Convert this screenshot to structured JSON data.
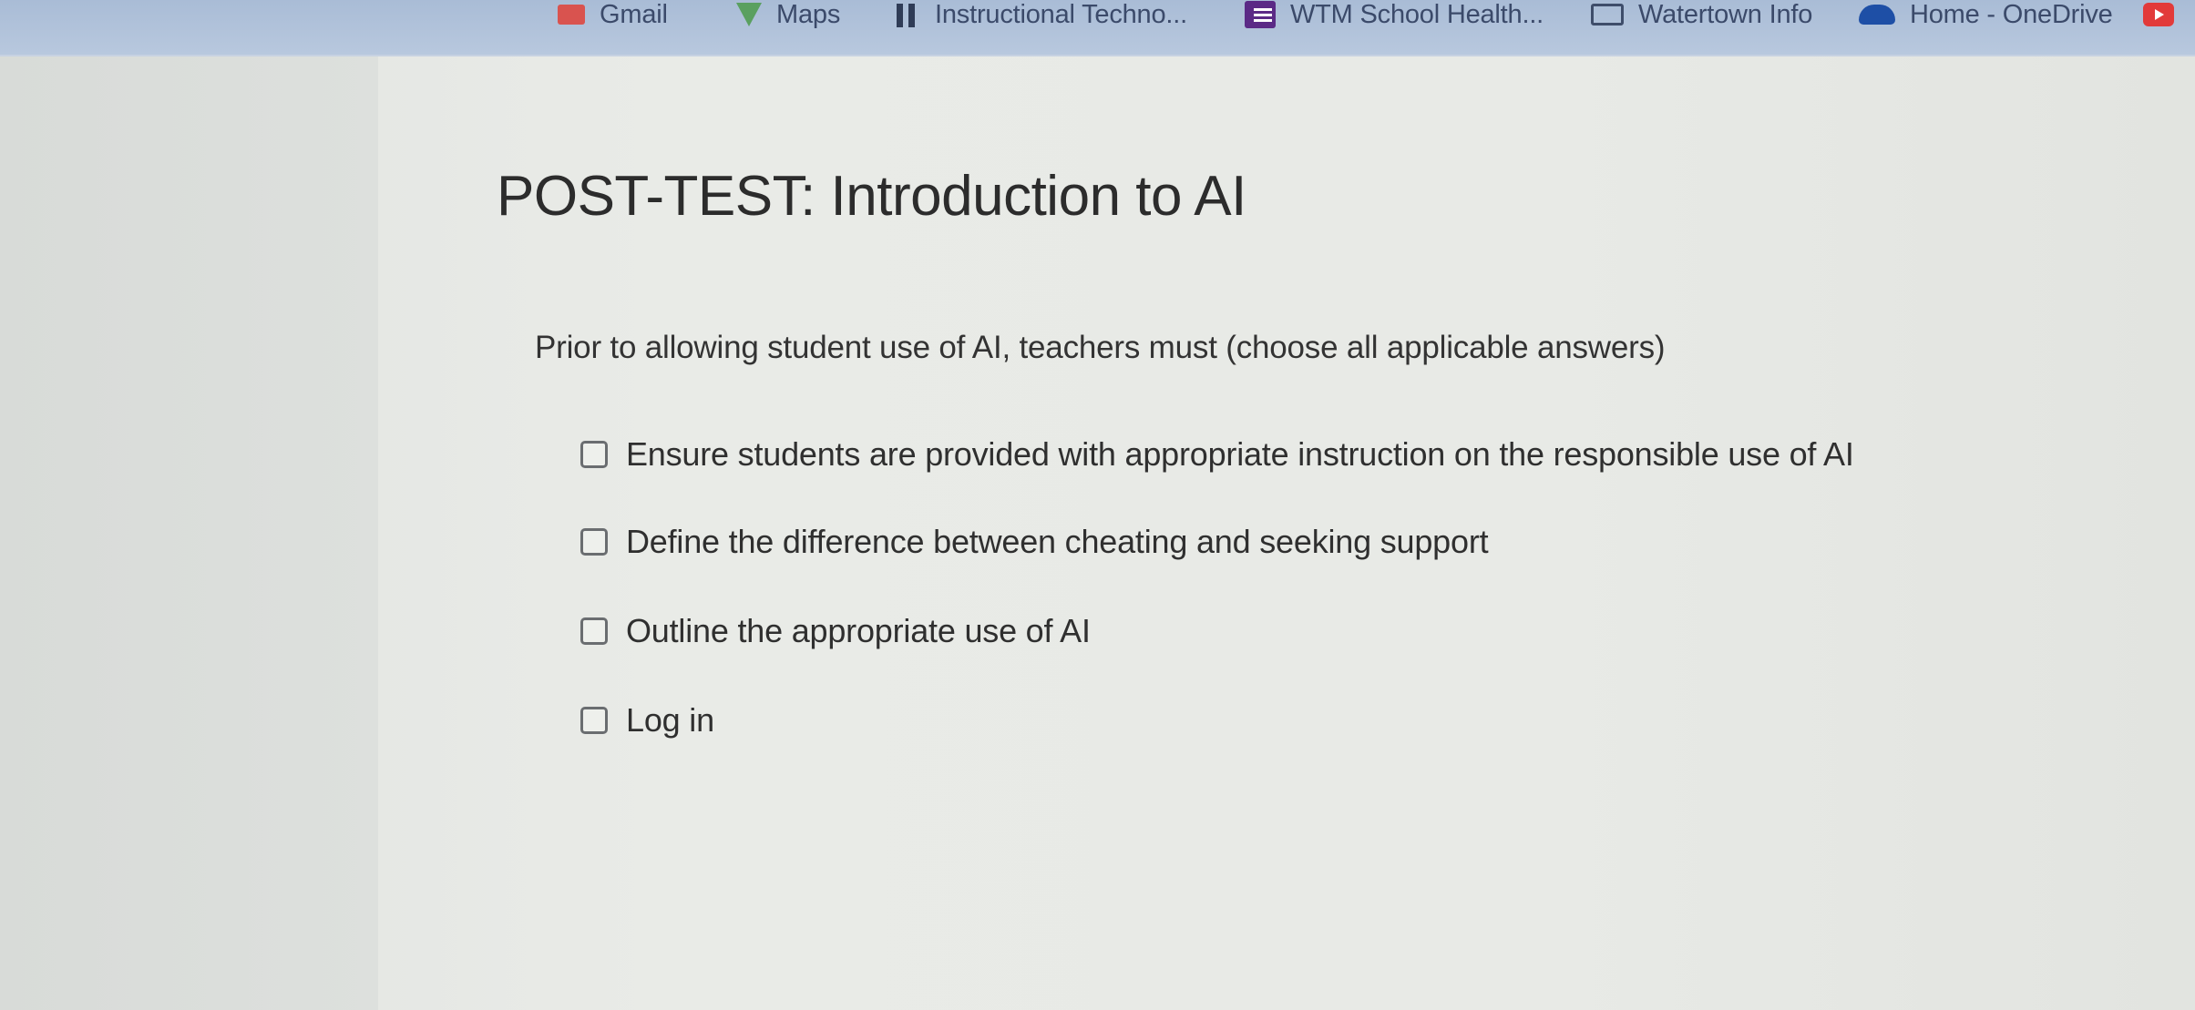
{
  "bookmarks": {
    "items": [
      {
        "label": "Gmail",
        "icon": "mail-icon"
      },
      {
        "label": "Maps",
        "icon": "maps-icon"
      },
      {
        "label": "Instructional Techno...",
        "icon": "instructional-tech-icon"
      },
      {
        "label": "WTM School Health...",
        "icon": "form-icon"
      },
      {
        "label": "Watertown Info",
        "icon": "folder-icon"
      },
      {
        "label": "Home - OneDrive",
        "icon": "onedrive-icon"
      }
    ]
  },
  "quiz": {
    "title": "POST-TEST: Introduction to AI",
    "question": "Prior to allowing student use of AI, teachers must (choose all applicable answers)",
    "options": [
      {
        "label": "Ensure students are provided with appropriate instruction on the responsible use of AI",
        "checked": false
      },
      {
        "label": "Define the difference between cheating and seeking support",
        "checked": false
      },
      {
        "label": "Outline the appropriate use of AI",
        "checked": false
      },
      {
        "label": "Log in",
        "checked": false
      }
    ]
  }
}
